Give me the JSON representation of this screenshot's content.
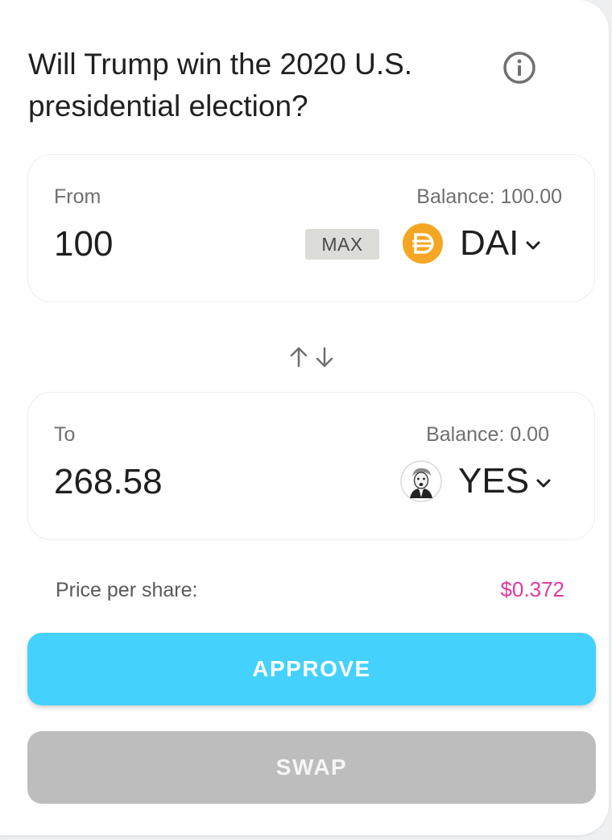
{
  "question": "Will Trump win the 2020 U.S. presidential election?",
  "from": {
    "label": "From",
    "balance": "Balance: 100.00",
    "amount": "100",
    "max_label": "MAX",
    "token": "DAI",
    "token_icon": "dai-coin-icon"
  },
  "to": {
    "label": "To",
    "balance": "Balance: 0.00",
    "amount": "268.58",
    "token": "YES",
    "token_icon": "trump-portrait-icon"
  },
  "price": {
    "label": "Price per share:",
    "value": "$0.372"
  },
  "buttons": {
    "approve": "APPROVE",
    "swap": "SWAP"
  },
  "colors": {
    "accent": "#44d1fd",
    "price": "#e0399e",
    "dai": "#f5a623",
    "disabled": "#bdbdbd"
  }
}
